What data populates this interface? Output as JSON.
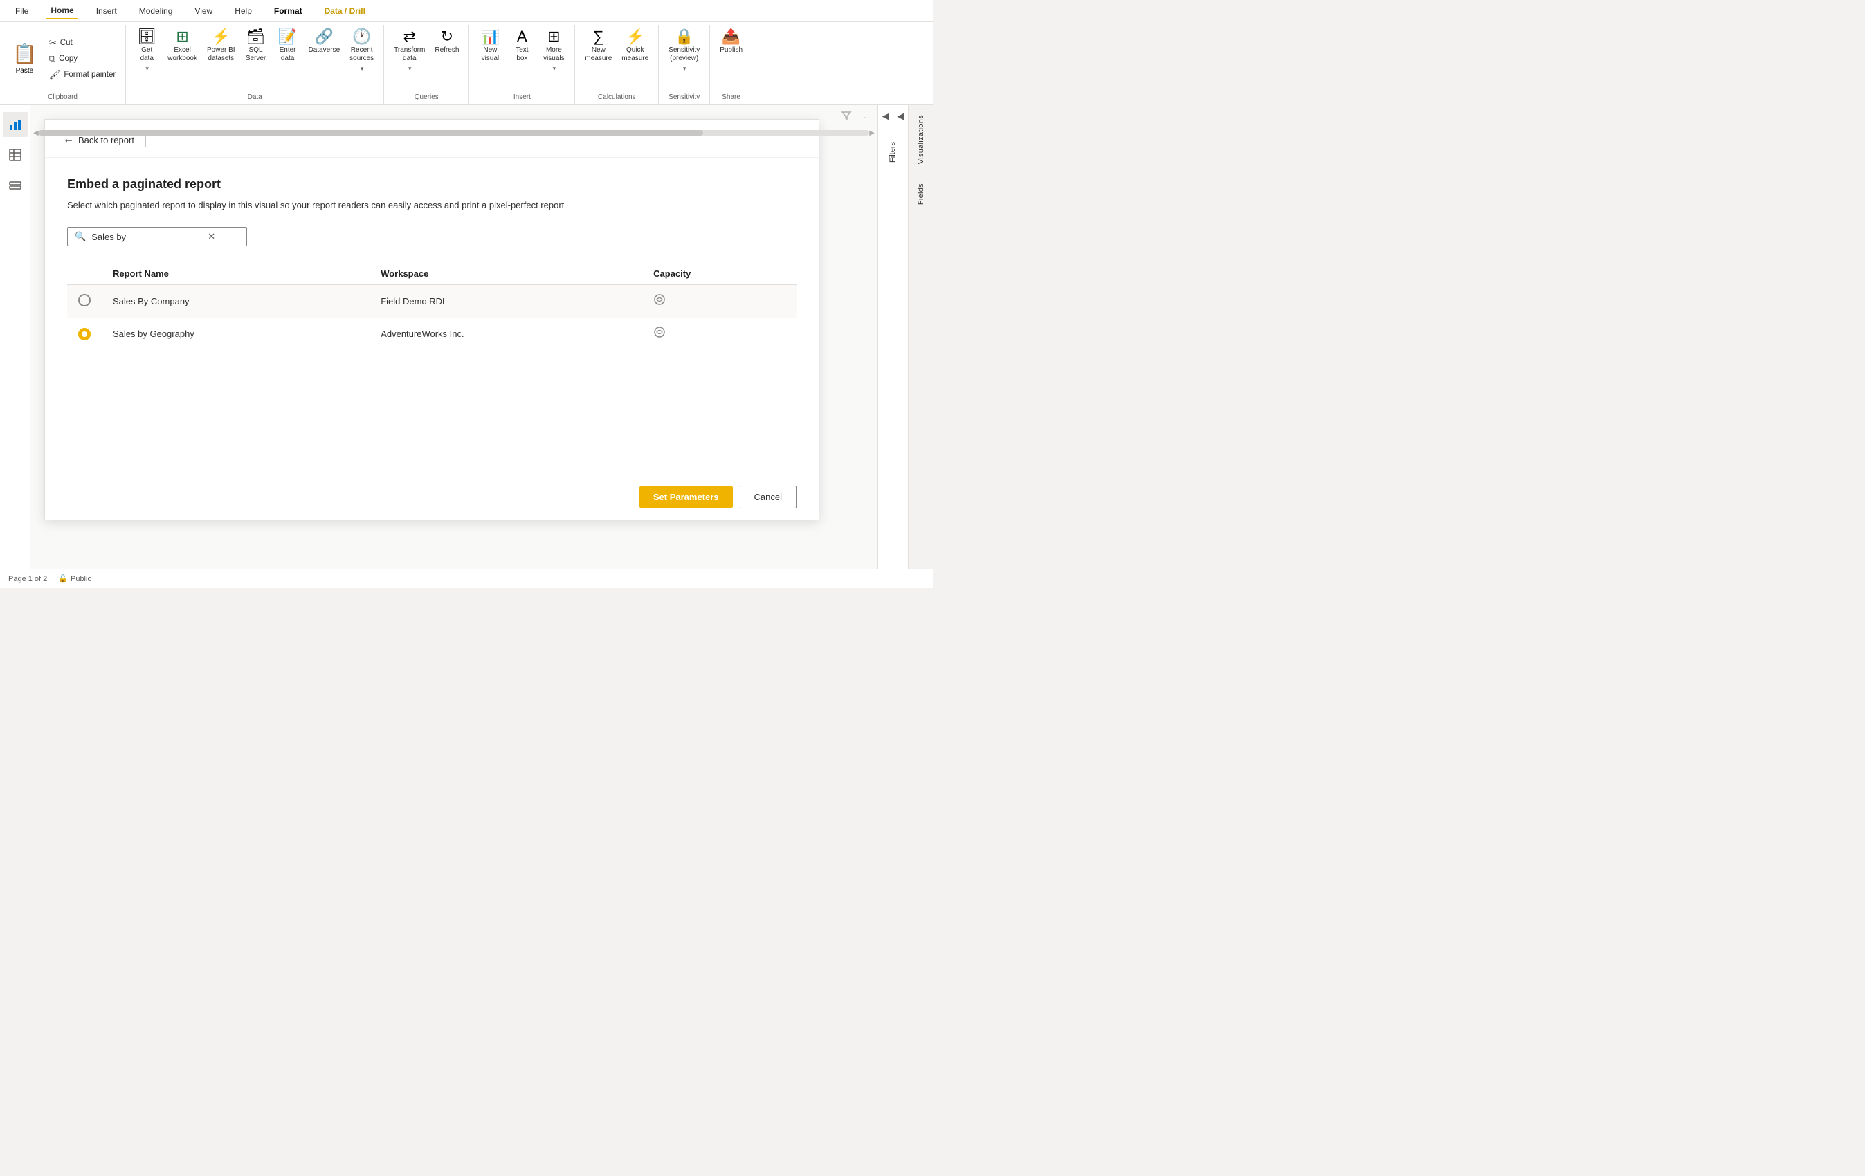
{
  "menu": {
    "items": [
      {
        "id": "file",
        "label": "File",
        "active": false
      },
      {
        "id": "home",
        "label": "Home",
        "active": true
      },
      {
        "id": "insert",
        "label": "Insert",
        "active": false
      },
      {
        "id": "modeling",
        "label": "Modeling",
        "active": false
      },
      {
        "id": "view",
        "label": "View",
        "active": false
      },
      {
        "id": "help",
        "label": "Help",
        "active": false
      },
      {
        "id": "format",
        "label": "Format",
        "active": true,
        "bold": true
      },
      {
        "id": "data-drill",
        "label": "Data / Drill",
        "active": true,
        "color": "gold"
      }
    ]
  },
  "ribbon": {
    "clipboard_group": {
      "label": "Clipboard",
      "paste_label": "Paste",
      "cut_label": "Cut",
      "copy_label": "Copy",
      "format_painter_label": "Format painter"
    },
    "data_group": {
      "label": "Data",
      "get_data_label": "Get\ndata",
      "excel_label": "Excel\nworkbook",
      "power_bi_label": "Power BI\ndatasets",
      "sql_label": "SQL\nServer",
      "enter_data_label": "Enter\ndata",
      "dataverse_label": "Dataverse",
      "recent_sources_label": "Recent\nsources"
    },
    "queries_group": {
      "label": "Queries",
      "transform_label": "Transform\ndata",
      "refresh_label": "Refresh"
    },
    "insert_group": {
      "label": "Insert",
      "new_visual_label": "New\nvisual",
      "text_box_label": "Text\nbox",
      "more_visuals_label": "More\nvisuals"
    },
    "calculations_group": {
      "label": "Calculations",
      "new_measure_label": "New\nmeasure",
      "quick_measure_label": "Quick\nmeasure"
    },
    "sensitivity_group": {
      "label": "Sensitivity",
      "sensitivity_label": "Sensitivity\n(preview)"
    },
    "share_group": {
      "label": "Share",
      "publish_label": "Publish"
    }
  },
  "dialog": {
    "back_button": "Back to report",
    "title": "Embed a paginated report",
    "description": "Select which paginated report to display in this visual so your report readers can easily access and print a pixel-perfect report",
    "search_placeholder": "Sales by",
    "search_value": "Sales by",
    "table": {
      "headers": [
        "Report Name",
        "Workspace",
        "Capacity"
      ],
      "rows": [
        {
          "id": 1,
          "selected": false,
          "report_name": "Sales By Company",
          "workspace": "Field Demo RDL",
          "has_capacity": true
        },
        {
          "id": 2,
          "selected": true,
          "report_name": "Sales by Geography",
          "workspace": "AdventureWorks Inc.",
          "has_capacity": true
        }
      ]
    },
    "set_parameters_btn": "Set Parameters",
    "cancel_btn": "Cancel"
  },
  "right_panel": {
    "nav_items": [
      "◀",
      "◀"
    ],
    "tabs": [
      {
        "label": "Filters"
      },
      {
        "label": "Visualizations"
      },
      {
        "label": "Fields"
      }
    ]
  },
  "left_sidebar": {
    "icons": [
      {
        "name": "bar-chart-icon",
        "symbol": "📊"
      },
      {
        "name": "table-icon",
        "symbol": "⊞"
      },
      {
        "name": "layers-icon",
        "symbol": "⊟"
      }
    ]
  },
  "status_bar": {
    "page_info": "Page 1 of 2",
    "public_label": "Public"
  }
}
